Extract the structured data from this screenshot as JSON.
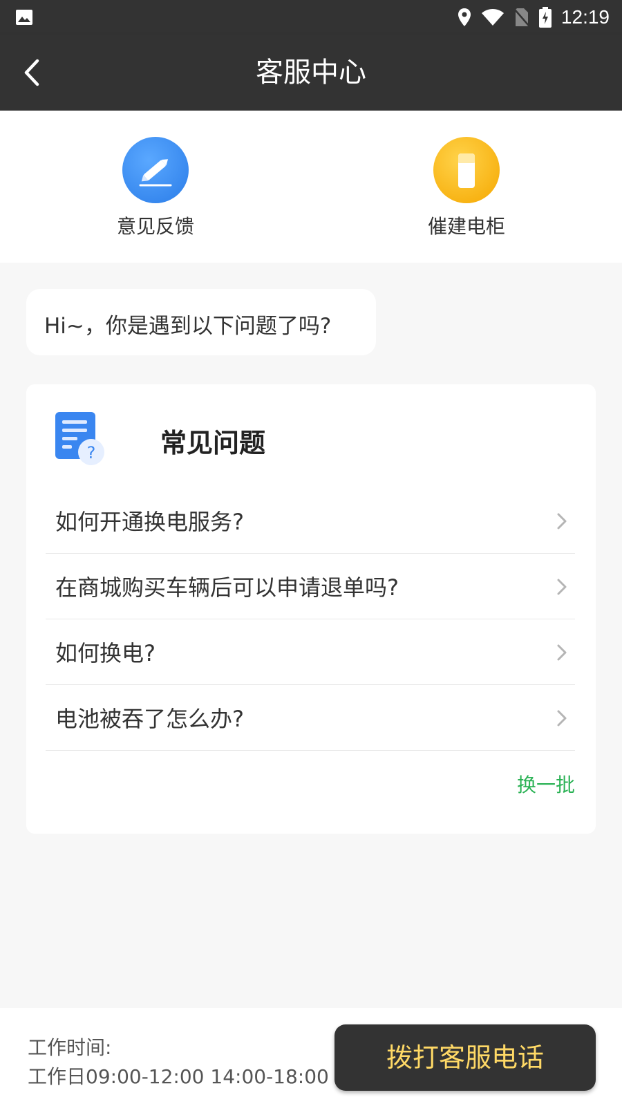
{
  "status_bar": {
    "time": "12:19",
    "icons": [
      "gallery-icon",
      "location-icon",
      "wifi-icon",
      "no-sim-icon",
      "battery-charging-icon"
    ]
  },
  "app_bar": {
    "title": "客服中心",
    "back_icon": "back-arrow-icon"
  },
  "shortcuts": [
    {
      "label": "意见反馈",
      "icon": "pencil-icon",
      "color": "#3a8ef5"
    },
    {
      "label": "催建电柜",
      "icon": "battery-cabinet-icon",
      "color": "#fbb916"
    }
  ],
  "greeting": "Hi~，你是遇到以下问题了吗?",
  "faq": {
    "title": "常见问题",
    "icon": "faq-document-icon",
    "items": [
      {
        "question": "如何开通换电服务?"
      },
      {
        "question": "在商城购买车辆后可以申请退单吗?"
      },
      {
        "question": "如何换电?"
      },
      {
        "question": "电池被吞了怎么办?"
      }
    ],
    "refresh_label": "换一批"
  },
  "footer": {
    "hours_label": "工作时间:",
    "hours_value": "工作日09:00-12:00 14:00-18:00",
    "call_button_label": "拨打客服电话"
  },
  "colors": {
    "header_bg": "#333333",
    "accent_green": "#2bb255",
    "call_text": "#ffd966"
  }
}
